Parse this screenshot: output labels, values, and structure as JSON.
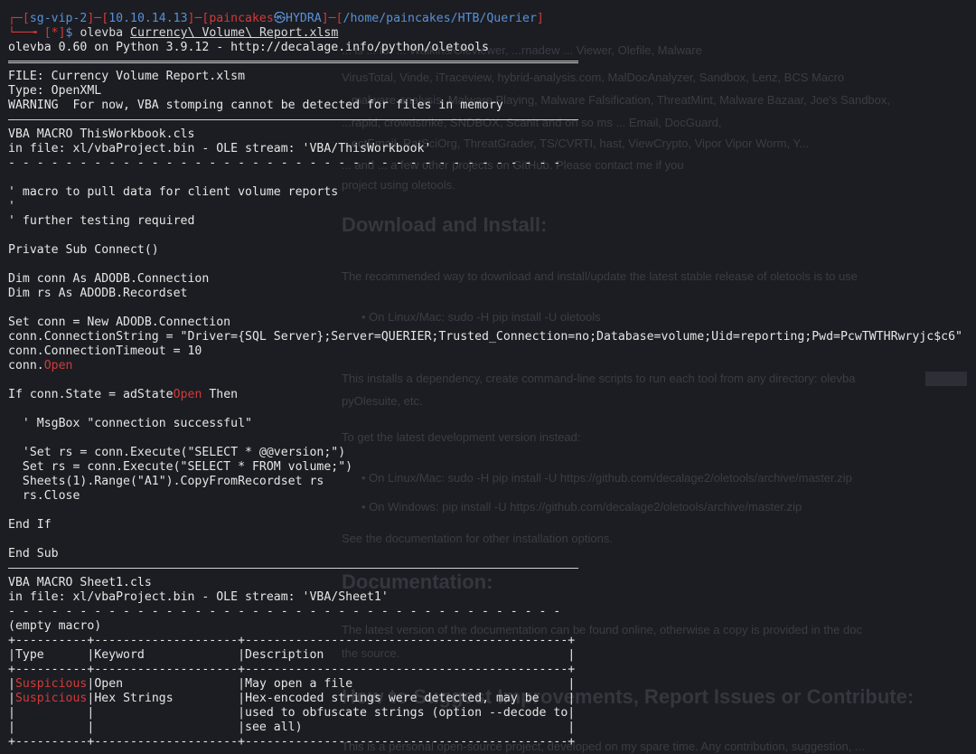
{
  "background": {
    "paragraphs": [
      "... is ... for ... Walkins/Oleviewer, ...rnadew ... Viewer, Olefile, Malware",
      "VirusTotal, Vinde, iTraceview, hybrid-analysis.com, MalDocAnalyzer, Sandbox, Lenz, BCS Macro",
      "...malware analysis, Malware Playing, Malware Falsification, ThreatMint, Malware Bazaar, Joe's Sandbox,",
      "...rapid, crowdstrike, SNDBOX, Scanit and on so ms ... Email, DocGuard,",
      "...ectEmail, RatSciOrg, ThreatGrader, TS/CVRTI, hast, ViewCrypto, Vipor Vipor Worm, Y...",
      "... and ... a few other projects on GitHub. Please contact me if you",
      "project using oletools."
    ],
    "h2_download": "Download and Install:",
    "p_download": "The recommended way to download and install/update the latest stable release of oletools is to use",
    "bullet_1": "On Linux/Mac: sudo -H pip install -U oletools",
    "p_setup": "This installs a dependency, create command-line scripts to run each tool from any directory: olevba",
    "p_setup2": "pyOlesuite, etc.",
    "p_latest": "To get the latest development version instead:",
    "bullet_2": "On Linux/Mac: sudo -H pip install -U https://github.com/decalage2/oletools/archive/master.zip",
    "bullet_3": "On Windows: pip install -U https://github.com/decalage2/oletools/archive/master.zip",
    "p_docs": "See the documentation for other installation options.",
    "h2_docs": "Documentation:",
    "p_docs2": "The latest version of the documentation can be found online, otherwise a copy is provided in the doc",
    "p_docs3": "the source.",
    "h2_help": "How to Suggest Improvements, Report Issues or Contribute:",
    "p_help": "This is a personal open-source project, developed on my spare time. Any contribution, suggestion, ..."
  },
  "prompt": {
    "session": "sg-vip-2",
    "ip": "10.10.14.13",
    "user": "paincakes",
    "at_symbol": "㉿",
    "host": "HYDRA",
    "path": "/home/paincakes/HTB/Querier",
    "status": "*",
    "dollar": "$",
    "command": "olevba",
    "argument": "Currency\\ Volume\\ Report.xlsm"
  },
  "lines": {
    "banner": "olevba 0.60 on Python 3.9.12 - http://decalage.info/python/oletools",
    "file": "FILE: Currency Volume Report.xlsm",
    "type": "Type: OpenXML",
    "warning": "WARNING  For now, VBA stomping cannot be detected for files in memory",
    "macro1_name": "VBA MACRO ThisWorkbook.cls",
    "macro1_stream": "in file: xl/vbaProject.bin - OLE stream: 'VBA/ThisWorkbook'",
    "dashes": "- - - - - - - - - - - - - - - - - - - - - - - - - - - - - - - - - - - - - - -",
    "c1": "' macro to pull data for client volume reports",
    "c2": "'",
    "c3": "' further testing required",
    "sub": "Private Sub Connect()",
    "dim_conn": "Dim conn As ADODB.Connection",
    "dim_rs": "Dim rs As ADODB.Recordset",
    "set_conn": "Set conn = New ADODB.Connection",
    "conn_string": "conn.ConnectionString = \"Driver={SQL Server};Server=QUERIER;Trusted_Connection=no;Database=volume;Uid=reporting;Pwd=PcwTWTHRwryjc$c6\"",
    "conn_timeout": "conn.ConnectionTimeout = 10",
    "conn_open_prefix": "conn.",
    "open_kw": "Open",
    "if_prefix": "If conn.State = adState",
    "if_suffix": " Then",
    "msgbox": "  ' MsgBox \"connection successful\"",
    "set_rs_comment": "  'Set rs = conn.Execute(\"SELECT * @@version;\")",
    "set_rs": "  Set rs = conn.Execute(\"SELECT * FROM volume;\")",
    "sheets": "  Sheets(1).Range(\"A1\").CopyFromRecordset rs",
    "rs_close": "  rs.Close",
    "end_if": "End If",
    "end_sub": "End Sub",
    "macro2_name": "VBA MACRO Sheet1.cls",
    "macro2_stream": "in file: xl/vbaProject.bin - OLE stream: 'VBA/Sheet1'",
    "empty_macro": "(empty macro)"
  },
  "table": {
    "border": "+----------+--------------------+---------------------------------------------+",
    "header": [
      "Type",
      "Keyword",
      "Description"
    ],
    "rows": [
      {
        "type": "Suspicious",
        "keyword": "Open",
        "description": [
          "May open a file"
        ]
      },
      {
        "type": "Suspicious",
        "keyword": "Hex Strings",
        "description": [
          "Hex-encoded strings were detected, may be",
          "used to obfuscate strings (option --decode to",
          "see all)"
        ]
      }
    ]
  },
  "colors": {
    "background": "#1b1d22",
    "text": "#e6e6e6",
    "accent_red": "#d23a3a",
    "accent_blue": "#5b8fd6"
  }
}
